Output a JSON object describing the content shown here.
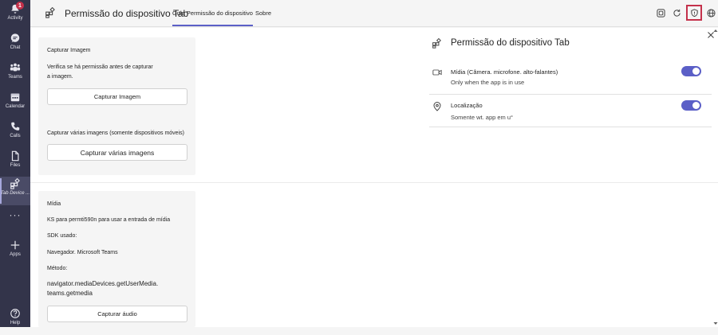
{
  "rail": {
    "items": [
      {
        "label": "Activity",
        "icon": "bell-icon",
        "badge": "1"
      },
      {
        "label": "Chat",
        "icon": "chat-icon"
      },
      {
        "label": "Teams",
        "icon": "teams-icon"
      },
      {
        "label": "Calendar",
        "icon": "calendar-icon"
      },
      {
        "label": "Calls",
        "icon": "phone-icon"
      },
      {
        "label": "Files",
        "icon": "file-icon"
      },
      {
        "label": "Tab Device ...",
        "icon": "app-grid-icon"
      },
      {
        "label": "",
        "icon": "more-icon"
      },
      {
        "label": "Apps",
        "icon": "plus-icon"
      },
      {
        "label": "Help",
        "icon": "help-icon"
      }
    ]
  },
  "header": {
    "app_title": "Permissão do dispositivo Tab",
    "tabs": [
      {
        "label": "Guia Permissão do dispositivo",
        "active": true
      },
      {
        "label": "Sobre",
        "active": false
      }
    ]
  },
  "card1": {
    "title": "Capturar Imagem",
    "desc_line1": "Verifica se há permissão antes de capturar",
    "desc_line2": "a imagem.",
    "button": "Capturar Imagem",
    "title2": "Capturar várias imagens (somente dispositivos móveis)",
    "button2": "Capturar várias imagens"
  },
  "card2": {
    "title": "Mídia",
    "line1": "KS para permti590n para usar a entrada de mídia",
    "line2": "SDK usado:",
    "line3": "Navegador. Microsoft Teams",
    "line4": "Método:",
    "line5a": "navigator.mediaDevices.getUserMedia.",
    "line5b": "teams.getmedia",
    "button": "Capturar áudio"
  },
  "panel": {
    "title": "Permissão do dispositivo Tab",
    "rows": [
      {
        "title": "Mídia (Câmera. microfone. alto-falantes)",
        "subtitle": "Only when the app is in use",
        "icon": "camera-icon",
        "enabled": true
      },
      {
        "title": "Localização",
        "subtitle": "Somente wt. app em u°",
        "icon": "location-icon",
        "enabled": true
      }
    ]
  },
  "colors": {
    "rail_bg": "#33344a",
    "accent": "#5b5fc7",
    "highlight": "#c4314b"
  }
}
